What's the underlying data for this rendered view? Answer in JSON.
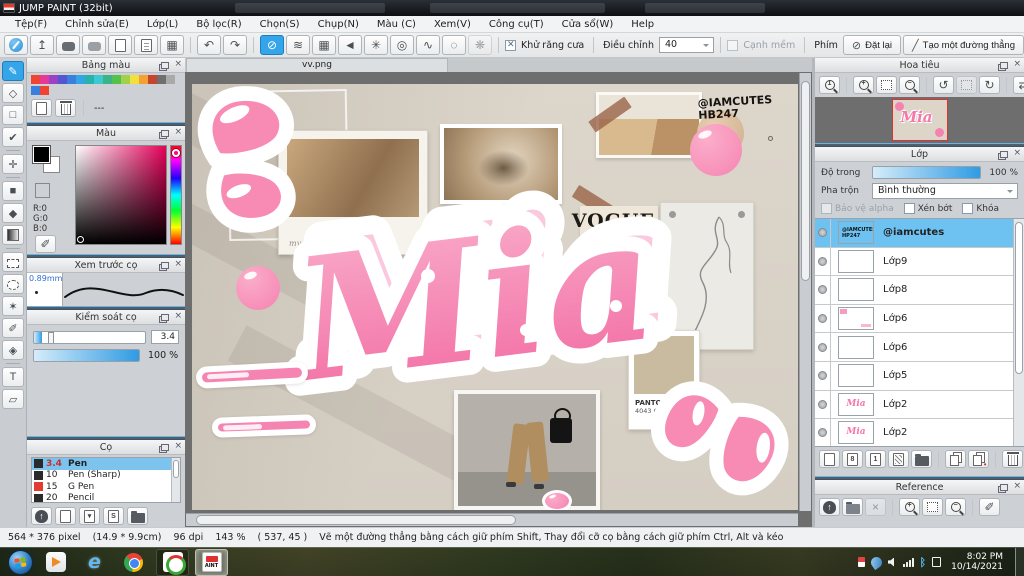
{
  "colors": {
    "selection_blue": "#54b2ec",
    "panel_bg": "#cdd1d5",
    "canvas_bg": "#6e6e6e",
    "sticker_pink": "#f78bb4",
    "nav_thumb_border": "#e03030"
  },
  "title_bar": {
    "app_title": "JUMP PAINT (32bit)"
  },
  "menu_bar": {
    "items": [
      "Tệp(F)",
      "Chỉnh sửa(E)",
      "Lớp(L)",
      "Bộ lọc(R)",
      "Chọn(S)",
      "Chụp(N)",
      "Màu (C)",
      "Xem(V)",
      "Công cụ(T)",
      "Cửa sổ(W)",
      "Help"
    ]
  },
  "toolbar": {
    "group_file": [
      {
        "n": "cloud-pen",
        "c": "ic-cloudpen"
      },
      {
        "n": "export",
        "g": "↥"
      },
      {
        "n": "comment",
        "c": "ic-bubble"
      },
      {
        "n": "comment-alt",
        "c": "ic-bubble light"
      },
      {
        "n": "document",
        "c": "ic-doc"
      },
      {
        "n": "document-list",
        "c": "ic-doc lines"
      },
      {
        "n": "grid-edit",
        "g": "▦"
      }
    ],
    "group_history": [
      {
        "n": "undo",
        "g": "↶"
      },
      {
        "n": "redo",
        "g": "↷"
      }
    ],
    "group_snap": [
      {
        "n": "snap-off",
        "g": "⊘",
        "a": 1
      },
      {
        "n": "snap-parallel",
        "g": "≋"
      },
      {
        "n": "snap-grid",
        "g": "▦"
      },
      {
        "n": "snap-vanishing-point",
        "g": "◄"
      },
      {
        "n": "snap-radial",
        "g": "✳"
      },
      {
        "n": "snap-concentric",
        "g": "◎"
      },
      {
        "n": "snap-curve",
        "g": "∿"
      },
      {
        "n": "snap-ellipse",
        "g": "◌"
      },
      {
        "n": "snap-symmetry",
        "g": "❋",
        "d": 1
      }
    ],
    "antialias_label": "Khử răng cưa",
    "adjust_label": "Điều chỉnh",
    "adjust_value": "40",
    "soft_label": "Cạnh mềm",
    "key_label": "Phím",
    "reset_label": "Đặt lại",
    "line_label": "Tạo một đường thẳng"
  },
  "tools": [
    {
      "n": "brush",
      "g": "✎",
      "a": 1
    },
    {
      "n": "eraser",
      "g": "◇"
    },
    {
      "n": "frame",
      "g": "□"
    },
    {
      "n": "polyline",
      "g": "✔"
    },
    {
      "sep": 1
    },
    {
      "n": "move",
      "g": "✛"
    },
    {
      "sep": 1
    },
    {
      "n": "fill-rect",
      "g": "■"
    },
    {
      "n": "bucket",
      "g": "◆"
    },
    {
      "n": "gradient",
      "c": "ic-grad"
    },
    {
      "sep": 1
    },
    {
      "n": "select-rect",
      "c": "ic-dash"
    },
    {
      "n": "select-lasso",
      "c": "ic-dash round"
    },
    {
      "n": "magic-wand",
      "g": "✶"
    },
    {
      "n": "select-pen",
      "g": "✐"
    },
    {
      "n": "select-eraser",
      "g": "◈"
    },
    {
      "sep": 1
    },
    {
      "n": "text",
      "g": "T"
    },
    {
      "n": "polygon-select",
      "g": "▱"
    }
  ],
  "panels": {
    "palette": {
      "title": "Bảng màu",
      "row1": [
        "#ef4431",
        "#e63897",
        "#9a41c6",
        "#5356cf",
        "#3a7ede",
        "#35a4e4",
        "#27b3ab",
        "#3cc9d2",
        "#3bb386",
        "#54c14e",
        "#a2d04b",
        "#f2e03c",
        "#f2a233",
        "#c5452f",
        "#6f6f6f",
        "#a9a9a9"
      ],
      "row2": [
        "#3a7ede",
        "#ef4431"
      ],
      "row2_empty": 14,
      "buttons": [
        {
          "n": "add-color",
          "c": "ic-doc"
        },
        {
          "n": "delete-color",
          "c": "ic-trash"
        }
      ],
      "dash_label": "---"
    },
    "color": {
      "title": "Màu",
      "r_label": "R:0",
      "g_label": "G:0",
      "b_label": "B:0"
    },
    "brush_preview": {
      "title": "Xem trước cọ",
      "size_label": "0.89mm"
    },
    "brush_control": {
      "title": "Kiểm soát cọ",
      "size_value": "3.4",
      "opacity_value": "100 %"
    },
    "brushes": {
      "title": "Cọ",
      "items": [
        {
          "size": "20",
          "name": "Pencil",
          "color": "#2a2a2a"
        },
        {
          "size": "3.4",
          "name": "Pen",
          "color": "#2a2a2a",
          "selected": true
        },
        {
          "size": "10",
          "name": "Pen (Sharp)",
          "color": "#2a2a2a"
        },
        {
          "size": "15",
          "name": "G Pen",
          "color": "#e23b30"
        }
      ],
      "buttons": [
        {
          "n": "cloud-brush",
          "c": "ic-tree"
        },
        {
          "n": "add-brush",
          "c": "ic-doc"
        },
        {
          "n": "brush-menu",
          "c": "ic-doc",
          "t": "▾"
        },
        {
          "n": "brush-script",
          "c": "ic-doc",
          "t": "S"
        },
        {
          "n": "brush-folder",
          "c": "ic-folder"
        }
      ]
    }
  },
  "canvas": {
    "tab_title": "vv.png",
    "watermark_line1": "@IAMCUTES",
    "watermark_line2": "HB247",
    "mia_text": "Mia",
    "caption": "my little space",
    "vogue": "VOGUE",
    "pantone_name": "PANTONE",
    "pantone_code": "4043 C"
  },
  "navigator": {
    "title": "Hoa tiêu",
    "buttons": [
      {
        "n": "zoom-actual",
        "c": "ic-mag",
        "t": "1"
      },
      {
        "sep": 1
      },
      {
        "n": "zoom-in",
        "c": "ic-mag",
        "t": "+"
      },
      {
        "n": "zoom-fit",
        "c": "ic-fit"
      },
      {
        "n": "zoom-out",
        "c": "ic-mag",
        "t": "−"
      },
      {
        "sep": 1
      },
      {
        "n": "rotate-left",
        "g": "↺"
      },
      {
        "n": "rotate-reset",
        "c": "ic-fit",
        "d": 1
      },
      {
        "n": "rotate-right",
        "g": "↻"
      },
      {
        "sep": 1
      },
      {
        "n": "flip-canvas",
        "g": "⇄"
      }
    ]
  },
  "layers": {
    "title": "Lớp",
    "opacity_label": "Độ trong",
    "opacity_value": "100 %",
    "blend_label": "Pha trộn",
    "blend_value": "Bình thường",
    "alpha_label": "Bảo vệ alpha",
    "clip_label": "Xén bớt",
    "lock_label": "Khóa",
    "items": [
      {
        "name": "@iamcutes",
        "thumb": "wm",
        "thumb_text": "@IAMCUTES HP247",
        "selected": true
      },
      {
        "name": "Lớp9",
        "thumb": "plain"
      },
      {
        "name": "Lớp8",
        "thumb": "plain"
      },
      {
        "name": "Lớp6",
        "thumb": "marks"
      },
      {
        "name": "Lớp6",
        "thumb": "plain"
      },
      {
        "name": "Lớp5",
        "thumb": "plain"
      },
      {
        "name": "Lớp2",
        "thumb": "mia",
        "thumb_text": "Mia"
      },
      {
        "name": "Lớp2",
        "thumb": "mia",
        "thumb_text": "Mia"
      }
    ],
    "buttons": [
      {
        "n": "new-layer",
        "c": "ic-doc"
      },
      {
        "n": "new-8bit-layer",
        "c": "ic-doc",
        "t": "8"
      },
      {
        "n": "new-1bit-layer",
        "c": "ic-doc",
        "t": "1"
      },
      {
        "n": "new-halftone-layer",
        "c": "ic-doc hatch"
      },
      {
        "n": "new-folder",
        "c": "ic-folder"
      },
      {
        "sep": 1
      },
      {
        "n": "duplicate-layer",
        "c": "ic-copy"
      },
      {
        "n": "merge-layer",
        "c": "ic-copy",
        "t": "•"
      },
      {
        "sep": 1
      },
      {
        "n": "delete-layer",
        "c": "ic-trash"
      }
    ]
  },
  "reference": {
    "title": "Reference",
    "buttons": [
      {
        "n": "import-reference",
        "c": "ic-tree"
      },
      {
        "n": "open-reference",
        "c": "ic-folder open"
      },
      {
        "n": "clear-reference",
        "g": "×",
        "d": 1
      },
      {
        "sep": 1
      },
      {
        "n": "ref-zoom-in",
        "c": "ic-mag",
        "t": "+"
      },
      {
        "n": "ref-zoom-fit",
        "c": "ic-fit"
      },
      {
        "n": "ref-zoom-out",
        "c": "ic-mag",
        "t": "−"
      },
      {
        "sep": 1
      },
      {
        "n": "ref-eyedropper",
        "g": "✐"
      }
    ]
  },
  "status_bar": {
    "size": "564 * 376 pixel",
    "dims": "(14.9 * 9.9cm)",
    "dpi": "96 dpi",
    "zoom": "143 %",
    "coords": "( 537, 45 )",
    "hint": "Vẽ một đường thẳng bằng cách giữ phím Shift, Thay đổi cỡ cọ bằng cách giữ phím Ctrl, Alt và kéo"
  },
  "taskbar": {
    "time": "8:02 PM",
    "date": "10/14/2021"
  }
}
